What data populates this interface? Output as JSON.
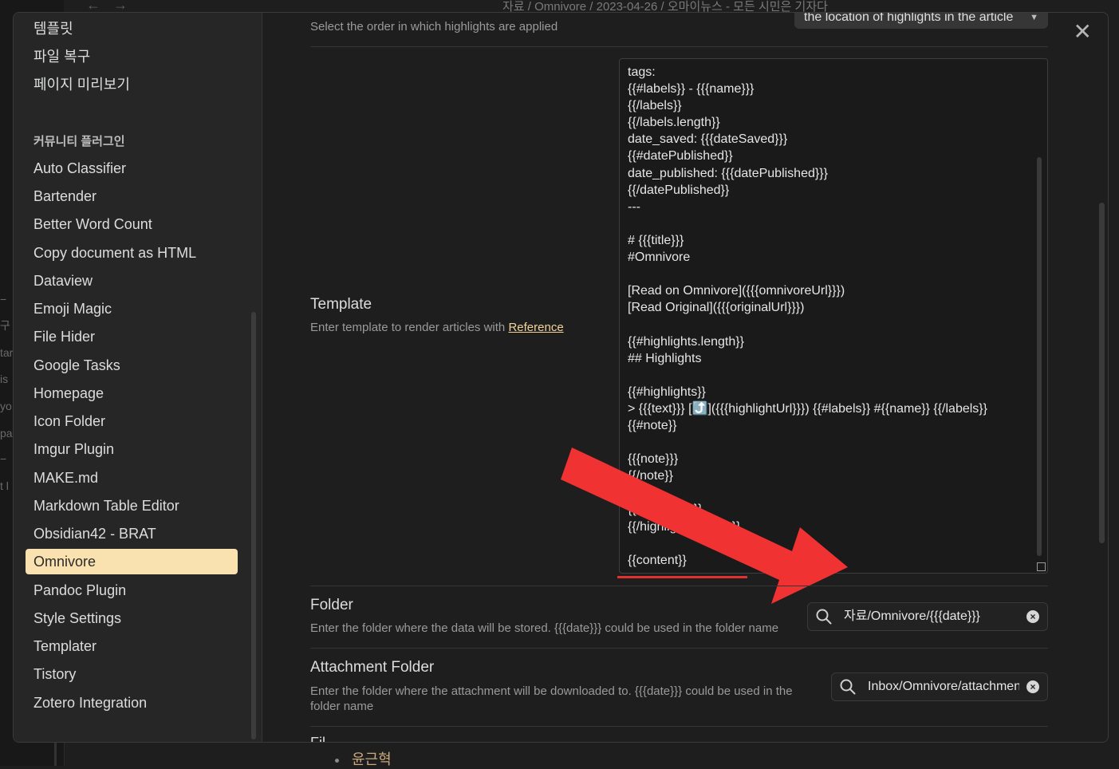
{
  "background": {
    "breadcrumb": "자료 / Omnivore / 2023-04-26 / 오마이뉴스 - 모든 시민은 기자다",
    "left_fragments": [
      "−",
      "구",
      "tar",
      "is",
      "yo",
      "pas",
      "−",
      "t l"
    ],
    "bottom_text": "윤근혁",
    "nav_back": "←",
    "nav_forward": "→"
  },
  "sidebar": {
    "core_items": [
      "템플릿",
      "파일 복구",
      "페이지 미리보기"
    ],
    "community_heading": "커뮤니티 플러그인",
    "community_items": [
      "Auto Classifier",
      "Bartender",
      "Better Word Count",
      "Copy document as HTML",
      "Dataview",
      "Emoji Magic",
      "File Hider",
      "Google Tasks",
      "Homepage",
      "Icon Folder",
      "Imgur Plugin",
      "MAKE.md",
      "Markdown Table Editor",
      "Obsidian42 - BRAT",
      "Omnivore",
      "Pandoc Plugin",
      "Style Settings",
      "Templater",
      "Tistory",
      "Zotero Integration"
    ],
    "active_item": "Omnivore"
  },
  "settings": {
    "highlight_order": {
      "desc": "Select the order in which highlights are applied",
      "dropdown_value": "the location of highlights in the article"
    },
    "template": {
      "name": "Template",
      "desc": "Enter template to render articles with ",
      "link": "Reference",
      "lines": [
        "tags:",
        "{{#labels}} - {{{name}}}",
        "{{/labels}}",
        "{{/labels.length}}",
        "date_saved: {{{dateSaved}}}",
        "{{#datePublished}}",
        "date_published: {{{datePublished}}}",
        "{{/datePublished}}",
        "---",
        "",
        "# {{{title}}}",
        "#Omnivore",
        "",
        "[Read on Omnivore]({{{omnivoreUrl}}})",
        "[Read Original]({{{originalUrl}}})",
        "",
        "{{#highlights.length}}",
        "## Highlights",
        "",
        "{{#highlights}}",
        "> {{{text}}} [⤴️]({{{highlightUrl}}}) {{#labels}} #{{name}} {{/labels}}",
        "{{#note}}",
        "",
        "{{{note}}}",
        "{{/note}}",
        "",
        "{{/highlights}}",
        "{{/highlights.length}}",
        "",
        "{{content}}"
      ]
    },
    "folder": {
      "name": "Folder",
      "desc": "Enter the folder where the data will be stored. {{{date}}} could be used in the folder name",
      "value": "자료/Omnivore/{{{date}}}"
    },
    "attachment_folder": {
      "name": "Attachment Folder",
      "desc": "Enter the folder where the attachment will be downloaded to. {{{date}}} could be used in the folder name",
      "value": "Inbox/Omnivore/attachments"
    },
    "next_partial": "Fil"
  },
  "icons": {
    "close": "close-icon",
    "search": "search-icon",
    "clear": "clear-icon"
  },
  "colors": {
    "active_item_bg": "#f9e1b0",
    "annotation_red": "#f03232",
    "link": "#f2d49a"
  }
}
